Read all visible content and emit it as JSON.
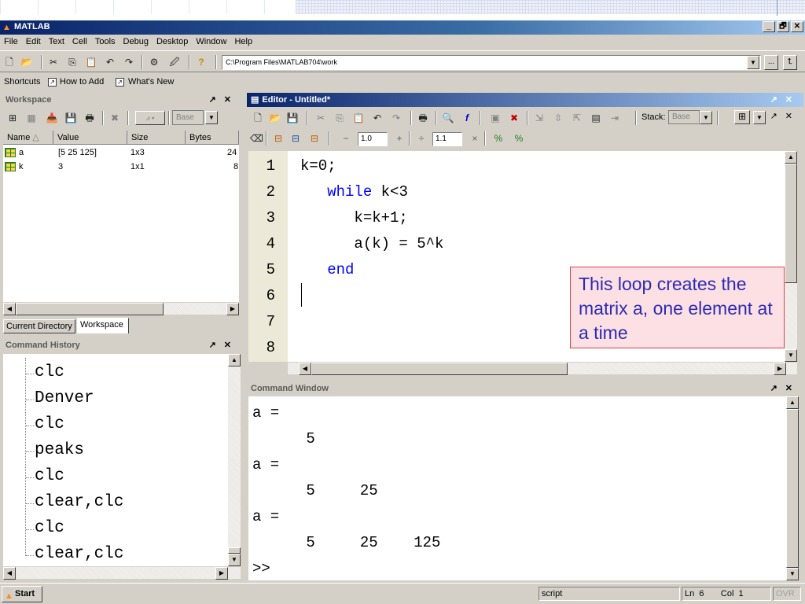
{
  "window": {
    "title": "MATLAB",
    "controls": [
      "_",
      "🗗",
      "✕"
    ]
  },
  "menu": [
    "File",
    "Edit",
    "Text",
    "Cell",
    "Tools",
    "Debug",
    "Desktop",
    "Window",
    "Help"
  ],
  "toolbar": {
    "current_directory": "C:\\Program Files\\MATLAB704\\work",
    "browse_label": "...",
    "icons": [
      "new-file-icon",
      "open-folder-icon",
      "cut-icon",
      "copy-icon",
      "paste-icon",
      "undo-icon",
      "redo-icon",
      "simulink-icon",
      "guide-icon",
      "help-icon",
      "up-folder-icon"
    ]
  },
  "shortcuts_bar": {
    "label": "Shortcuts",
    "items": [
      "How to Add",
      "What's New"
    ]
  },
  "workspace": {
    "title": "Workspace",
    "stack_value": "Base",
    "columns": [
      "Name",
      "Value",
      "Size",
      "Bytes"
    ],
    "sort_indicator": "△",
    "rows": [
      {
        "name": "a",
        "value": "[5 25 125]",
        "size": "1x3",
        "bytes": "24"
      },
      {
        "name": "k",
        "value": "3",
        "size": "1x1",
        "bytes": "8"
      }
    ]
  },
  "tabs": [
    "Current Directory",
    "Workspace"
  ],
  "history": {
    "title": "Command History",
    "items": [
      "clc",
      "Denver",
      "clc",
      "peaks",
      "clc",
      "clear,clc",
      "clc",
      "clear,clc"
    ]
  },
  "editor": {
    "title": "Editor - Untitled*",
    "zoom1": "1.0",
    "zoom2": "1.1",
    "stack_label": "Stack:",
    "stack_value": "Base",
    "line_numbers": [
      "1",
      "2",
      "3",
      "4",
      "5",
      "6",
      "7",
      "8"
    ],
    "lines": [
      {
        "indent": "",
        "kw": "",
        "text": "k=0;"
      },
      {
        "indent": "   ",
        "kw": "while",
        "text": " k<3"
      },
      {
        "indent": "      ",
        "kw": "",
        "text": "k=k+1;"
      },
      {
        "indent": "      ",
        "kw": "",
        "text": "a(k) = 5^k"
      },
      {
        "indent": "   ",
        "kw": "end",
        "text": ""
      },
      {
        "indent": "",
        "kw": "",
        "text": ""
      },
      {
        "indent": "",
        "kw": "",
        "text": ""
      },
      {
        "indent": "",
        "kw": "",
        "text": ""
      }
    ]
  },
  "callout": {
    "text": "This loop creates the matrix a, one element at a time"
  },
  "command_window": {
    "title": "Command Window",
    "lines": [
      "a =",
      "      5",
      "a =",
      "      5     25",
      "a =",
      "      5     25    125",
      ">>"
    ]
  },
  "statusbar": {
    "start": "Start",
    "mode": "script",
    "ln_label": "Ln",
    "ln": "6",
    "col_label": "Col",
    "col": "1",
    "ovr": "OVR"
  }
}
